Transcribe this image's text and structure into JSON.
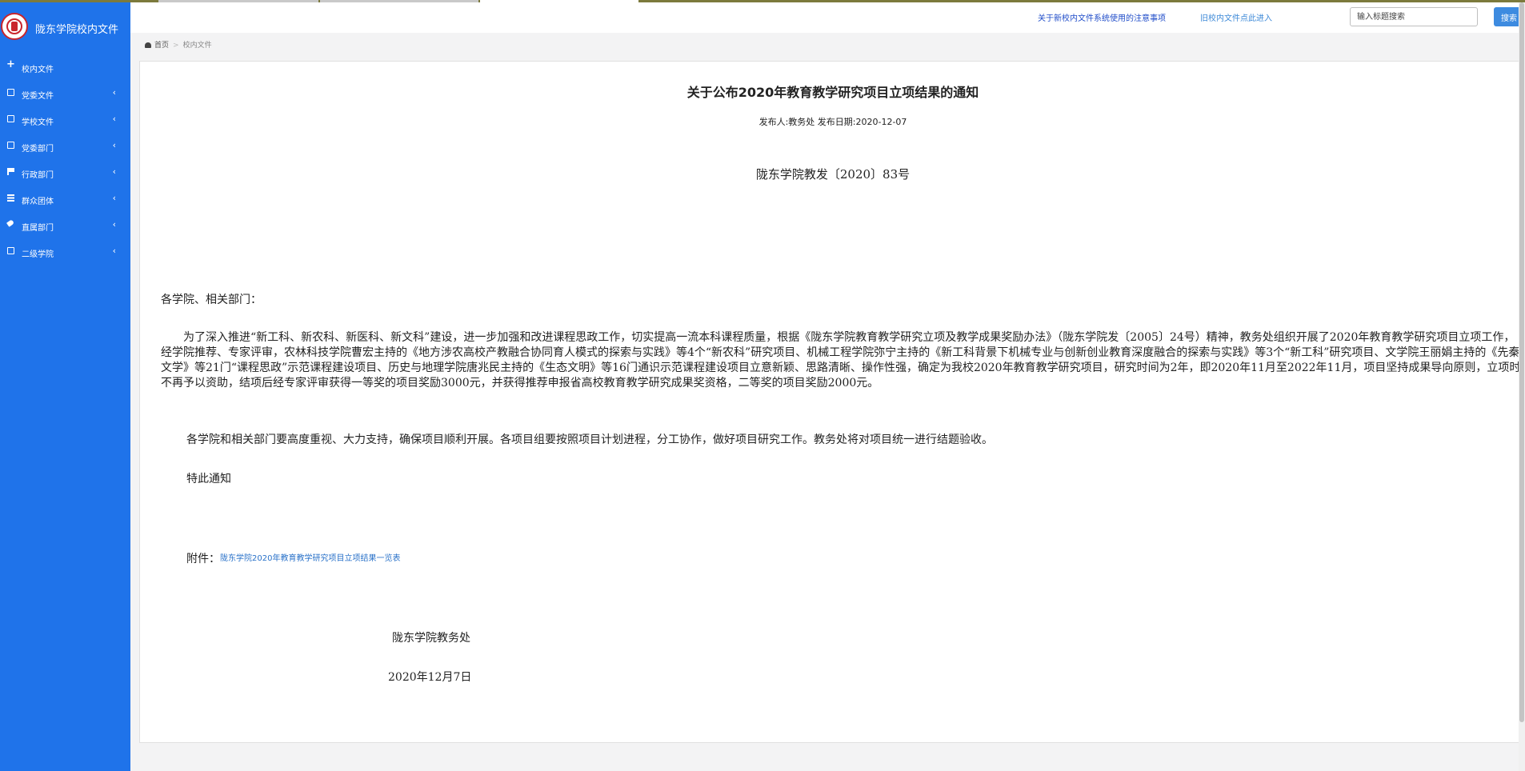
{
  "brand": {
    "title": "陇东学院校内文件"
  },
  "sidebar": {
    "items": [
      {
        "label": "校内文件",
        "icon": "plus-icon",
        "expandable": false
      },
      {
        "label": "党委文件",
        "icon": "document-icon",
        "expandable": true
      },
      {
        "label": "学校文件",
        "icon": "document-icon",
        "expandable": true
      },
      {
        "label": "党委部门",
        "icon": "list-icon",
        "expandable": true
      },
      {
        "label": "行政部门",
        "icon": "bookmark-icon",
        "expandable": true
      },
      {
        "label": "群众团体",
        "icon": "calendar-icon",
        "expandable": true
      },
      {
        "label": "直属部门",
        "icon": "tag-icon",
        "expandable": true
      },
      {
        "label": "二级学院",
        "icon": "document-icon",
        "expandable": true
      }
    ],
    "chevron": "‹"
  },
  "topbar": {
    "notice_link": "关于新校内文件系统使用的注意事项",
    "old_link": "旧校内文件点此进入",
    "search_placeholder": "输入标题搜索",
    "search_button": "搜索"
  },
  "breadcrumb": {
    "home": "首页",
    "separator": ">",
    "current": "校内文件"
  },
  "document": {
    "title": "关于公布2020年教育教学研究项目立项结果的通知",
    "meta": "发布人:教务处  发布日期:2020-12-07",
    "doc_number": "陇东学院教发〔2020〕83号",
    "salutation": "各学院、相关部门：",
    "paragraph1": "为了深入推进“新工科、新农科、新医科、新文科”建设，进一步加强和改进课程思政工作，切实提高一流本科课程质量，根据《陇东学院教育教学研究立项及教学成果奖励办法》（陇东学院发〔2005〕24号）精神，教务处组织开展了2020年教育教学研究项目立项工作，经学院推荐、专家评审，农林科技学院曹宏主持的《地方涉农高校产教融合协同育人模式的探索与实践》等4个“新农科”研究项目、机械工程学院弥宁主持的《新工科背景下机械专业与创新创业教育深度融合的探索与实践》等3个“新工科”研究项目、文学院王丽娟主持的《先秦文学》等21门“课程思政”示范课程建设项目、历史与地理学院唐兆民主持的《生态文明》等16门通识示范课程建设项目立意新颖、思路清晰、操作性强，确定为我校2020年教育教学研究项目，研究时间为2年，即2020年11月至2022年11月，项目坚持成果导向原则，立项时不再予以资助，结项后经专家评审获得一等奖的项目奖励3000元，并获得推荐申报省高校教育教学研究成果奖资格，二等奖的项目奖励2000元。",
    "paragraph2": "各学院和相关部门要高度重视、大力支持，确保项目顺利开展。各项目组要按照项目计划进程，分工协作，做好项目研究工作。教务处将对项目统一进行结题验收。",
    "paragraph3": "特此通知",
    "attachment_label": "附件：",
    "attachment_link": "陇东学院2020年教育教学研究项目立项结果一览表",
    "signature": "陇东学院教务处",
    "date": "2020年12月7日"
  }
}
